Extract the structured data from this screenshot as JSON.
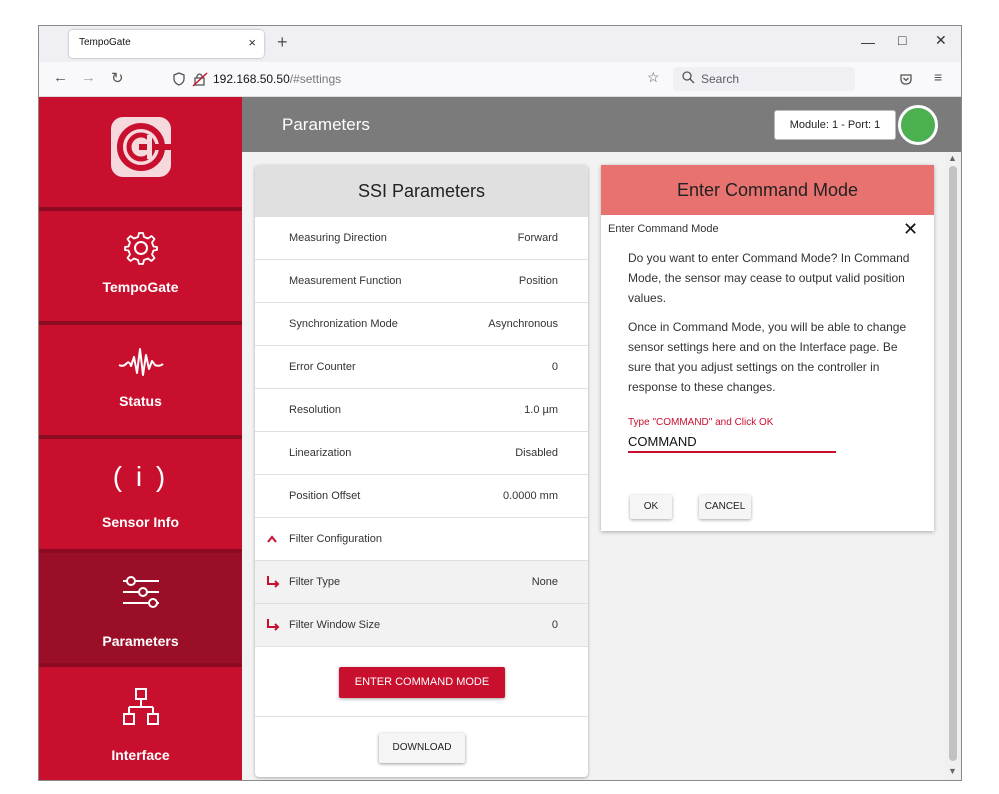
{
  "browser": {
    "tab_title": "TempoGate",
    "tab_close": "×",
    "new_tab": "+",
    "url_host": "192.168.50.50",
    "url_path": "/#settings",
    "search_placeholder": "Search"
  },
  "sidebar": {
    "items": [
      {
        "label": "TempoGate",
        "icon": "gear-icon"
      },
      {
        "label": "Status",
        "icon": "signal-wave-icon"
      },
      {
        "label": "Sensor Info",
        "icon": "info-icon"
      },
      {
        "label": "Parameters",
        "icon": "sliders-icon",
        "active": true
      },
      {
        "label": "Interface",
        "icon": "network-icon"
      }
    ],
    "info_glyph": "( i )"
  },
  "header": {
    "title": "Parameters",
    "module_port": "Module: 1 - Port: 1",
    "status_color": "#4caf50"
  },
  "ssi": {
    "title": "SSI Parameters",
    "rows": [
      {
        "label": "Measuring Direction",
        "value": "Forward"
      },
      {
        "label": "Measurement Function",
        "value": "Position"
      },
      {
        "label": "Synchronization Mode",
        "value": "Asynchronous"
      },
      {
        "label": "Error Counter",
        "value": "0"
      },
      {
        "label": "Resolution",
        "value": "1.0 µm"
      },
      {
        "label": "Linearization",
        "value": "Disabled"
      },
      {
        "label": "Position Offset",
        "value": "0.0000 mm"
      }
    ],
    "filter_section": "Filter Configuration",
    "filter_rows": [
      {
        "label": "Filter Type",
        "value": "None"
      },
      {
        "label": "Filter Window Size",
        "value": "0"
      }
    ],
    "enter_button": "ENTER COMMAND MODE",
    "download_button": "DOWNLOAD"
  },
  "dialog": {
    "title": "Enter Command Mode",
    "subtitle": "Enter Command Mode",
    "close": "✕",
    "p1": "Do you want to enter Command Mode? In Command Mode, the sensor may cease to output valid position values.",
    "p2": "Once in Command Mode, you will be able to change sensor settings here and on the Interface page. Be sure that you adjust settings on the controller in response to these changes.",
    "input_label": "Type \"COMMAND\" and Click OK",
    "input_value": "COMMAND",
    "ok": "OK",
    "cancel": "CANCEL"
  },
  "colors": {
    "brand_red": "#c8102e",
    "sidebar_active": "#9a0e27",
    "dialog_header": "#e8726f"
  }
}
